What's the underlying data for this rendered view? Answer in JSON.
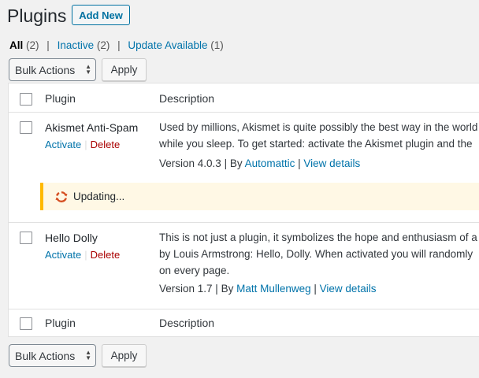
{
  "header": {
    "title": "Plugins",
    "add_new_label": "Add New"
  },
  "filters": {
    "all": {
      "label": "All",
      "count": "(2)"
    },
    "inactive": {
      "label": "Inactive",
      "count": "(2)"
    },
    "update": {
      "label": "Update Available",
      "count": "(1)"
    },
    "separator": "|"
  },
  "bulk_top": {
    "selected": "Bulk Actions",
    "apply_label": "Apply"
  },
  "bulk_bottom": {
    "selected": "Bulk Actions",
    "apply_label": "Apply"
  },
  "table": {
    "columns": {
      "plugin": "Plugin",
      "description": "Description"
    },
    "rows": [
      {
        "name": "Akismet Anti-Spam",
        "activate": "Activate",
        "delete": "Delete",
        "description_line1": "Used by millions, Akismet is quite possibly the best way in the world",
        "description_line2": "while you sleep. To get started: activate the Akismet plugin and the",
        "version": "Version 4.0.3",
        "by": "By",
        "author": "Automattic",
        "view_details": "View details"
      },
      {
        "name": "Hello Dolly",
        "activate": "Activate",
        "delete": "Delete",
        "description_line1": "This is not just a plugin, it symbolizes the hope and enthusiasm of a",
        "description_line2": "by Louis Armstrong: Hello, Dolly. When activated you will randomly",
        "description_line3": "on every page.",
        "version": "Version 1.7",
        "by": "By",
        "author": "Matt Mullenweg",
        "view_details": "View details"
      }
    ],
    "update_notice": "Updating..."
  },
  "colors": {
    "link": "#0073aa",
    "delete": "#aa0000",
    "notice_border": "#ffb900",
    "notice_bg": "#fff8e5",
    "spinner": "#d54e21"
  },
  "icons": {
    "updating": "update-spinner-icon",
    "select": "select-arrows-icon"
  }
}
